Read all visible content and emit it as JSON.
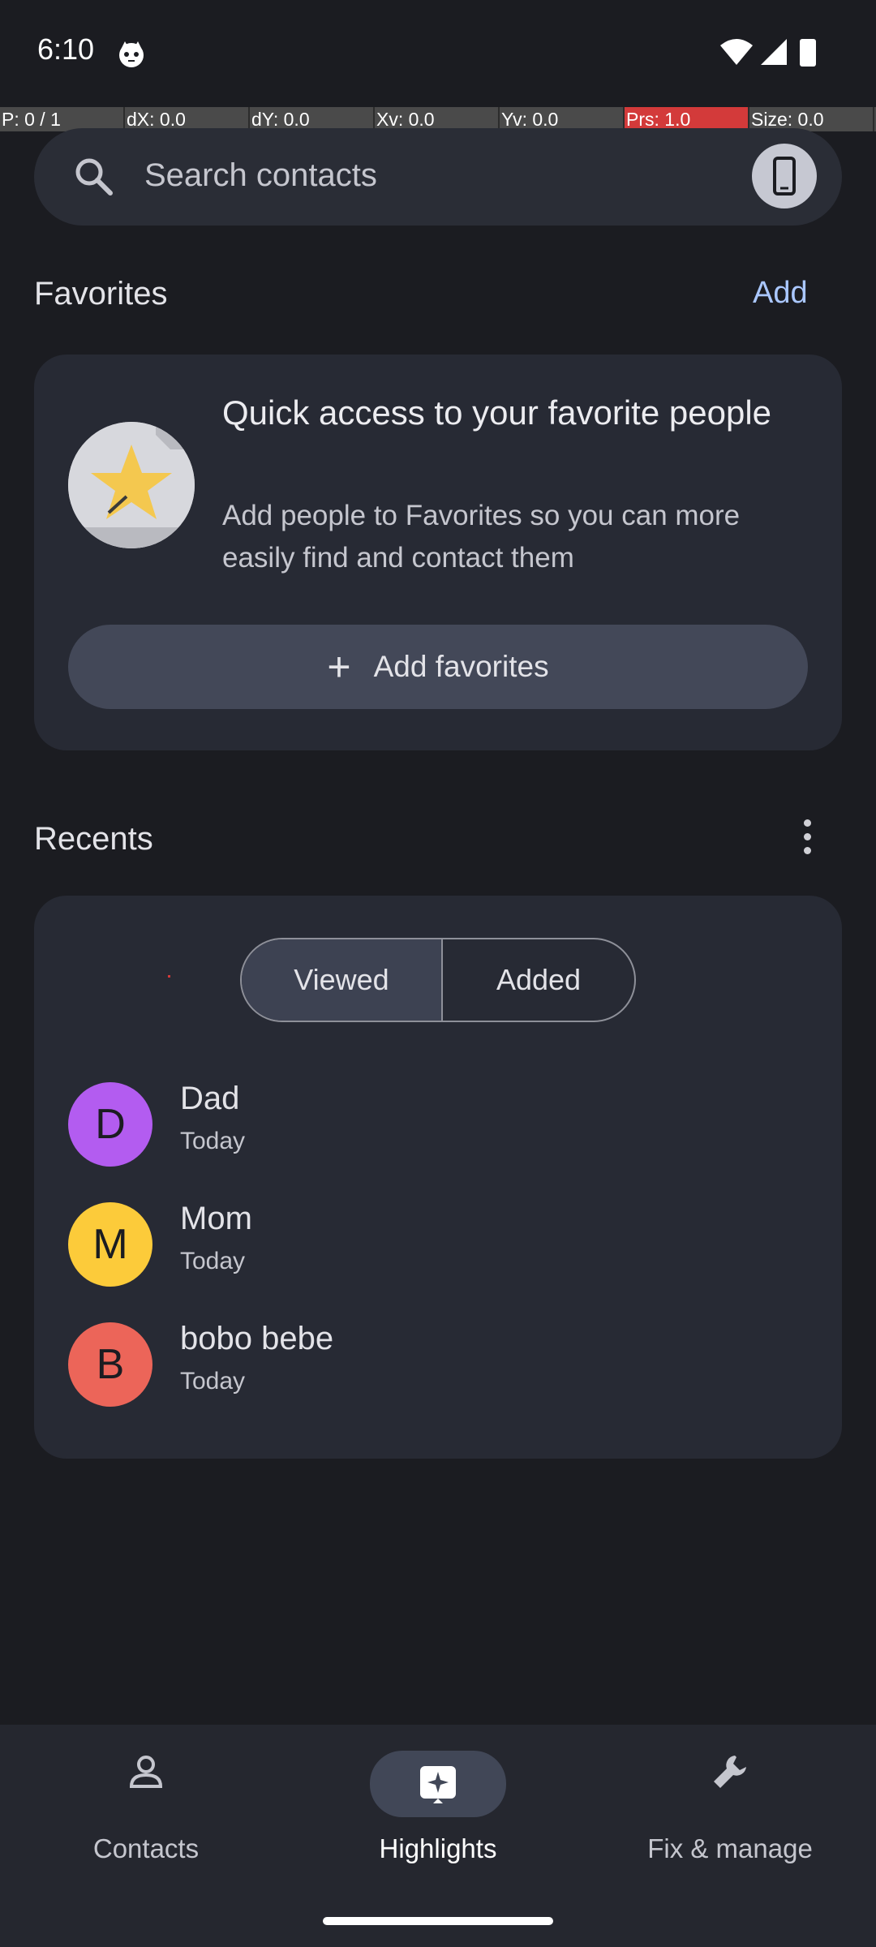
{
  "status_bar": {
    "time": "6:10",
    "icons": [
      "cat-icon",
      "wifi-icon",
      "signal-icon",
      "battery-icon"
    ]
  },
  "debug_bar": {
    "fields": [
      "P: 0 / 1",
      "dX: 0.0",
      "dY: 0.0",
      "Xv: 0.0",
      "Yv: 0.0",
      "Prs: 1.0",
      "Size: 0.0"
    ]
  },
  "search": {
    "placeholder": "Search contacts",
    "icons": [
      "search-icon",
      "phone-device-icon"
    ]
  },
  "favorites": {
    "header": "Favorites",
    "add_label": "Add",
    "card_title": "Quick access to your favorite people",
    "card_description": "Add people to Favorites so you can more easily find and contact them",
    "add_favorites_label": "Add favorites",
    "icons": [
      "star-icon",
      "plus-icon"
    ]
  },
  "recents": {
    "header": "Recents",
    "more_icon": "more-vert-icon",
    "tabs": [
      {
        "label": "Viewed",
        "selected": true
      },
      {
        "label": "Added",
        "selected": false
      }
    ],
    "contacts": [
      {
        "initial": "D",
        "name": "Dad",
        "subtitle": "Today",
        "color": "#b35cf0"
      },
      {
        "initial": "M",
        "name": "Mom",
        "subtitle": "Today",
        "color": "#fccb3a"
      },
      {
        "initial": "B",
        "name": "bobo bebe",
        "subtitle": "Today",
        "color": "#ec6559"
      }
    ]
  },
  "bottom_nav": {
    "items": [
      {
        "label": "Contacts",
        "icon": "person-icon",
        "selected": false
      },
      {
        "label": "Highlights",
        "icon": "highlights-icon",
        "selected": true
      },
      {
        "label": "Fix & manage",
        "icon": "wrench-icon",
        "selected": false
      }
    ]
  },
  "colors": {
    "background": "#1b1c21",
    "card": "#272a34",
    "accent_link": "#aac7ff",
    "debug_highlight": "#d33a3a"
  }
}
